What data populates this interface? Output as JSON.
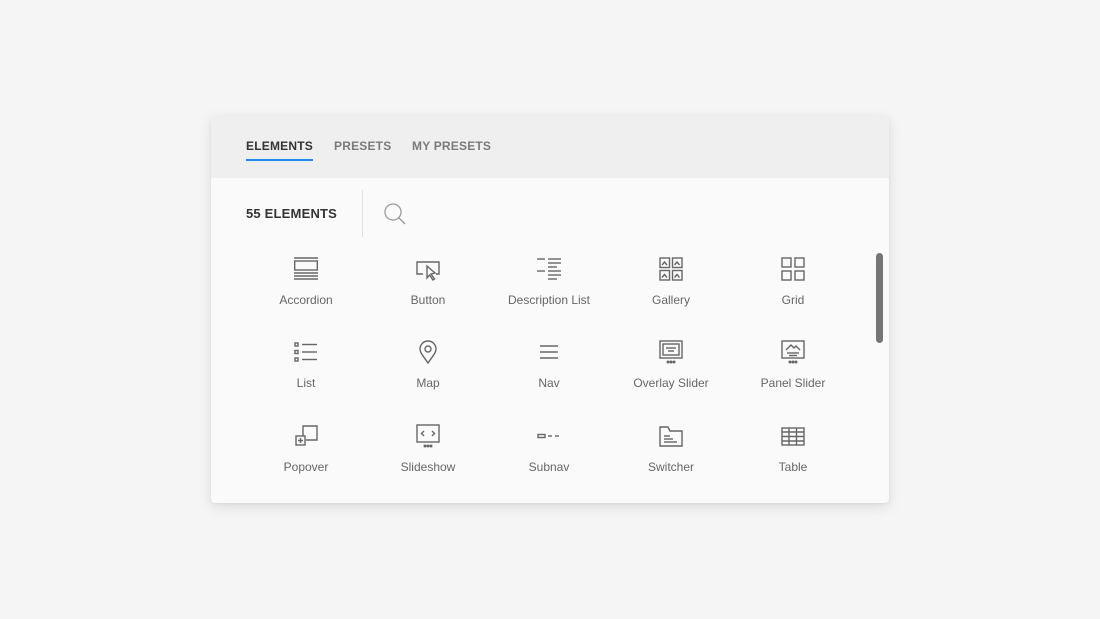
{
  "tabs": [
    {
      "label": "ELEMENTS",
      "active": true
    },
    {
      "label": "PRESETS",
      "active": false
    },
    {
      "label": "MY PRESETS",
      "active": false
    }
  ],
  "count_label": "55 ELEMENTS",
  "search": {
    "placeholder": "",
    "value": ""
  },
  "elements": [
    {
      "label": "Accordion",
      "icon": "accordion-icon"
    },
    {
      "label": "Button",
      "icon": "button-icon"
    },
    {
      "label": "Description List",
      "icon": "description-list-icon"
    },
    {
      "label": "Gallery",
      "icon": "gallery-icon"
    },
    {
      "label": "Grid",
      "icon": "grid-icon"
    },
    {
      "label": "List",
      "icon": "list-icon"
    },
    {
      "label": "Map",
      "icon": "map-pin-icon"
    },
    {
      "label": "Nav",
      "icon": "nav-icon"
    },
    {
      "label": "Overlay Slider",
      "icon": "overlay-slider-icon"
    },
    {
      "label": "Panel Slider",
      "icon": "panel-slider-icon"
    },
    {
      "label": "Popover",
      "icon": "popover-icon"
    },
    {
      "label": "Slideshow",
      "icon": "slideshow-icon"
    },
    {
      "label": "Subnav",
      "icon": "subnav-icon"
    },
    {
      "label": "Switcher",
      "icon": "switcher-icon"
    },
    {
      "label": "Table",
      "icon": "table-icon"
    }
  ],
  "colors": {
    "accent": "#1e87f0",
    "text": "#333333",
    "muted": "#666666"
  }
}
